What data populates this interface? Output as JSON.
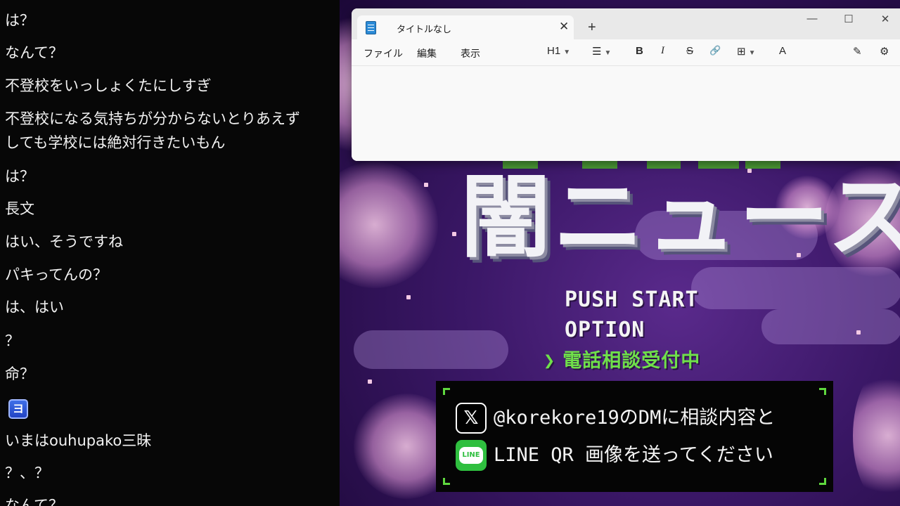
{
  "chat": {
    "messages": [
      "は？",
      "なんて？",
      "不登校をいっしょくたにしすぎ",
      "不登校になる気持ちが分からないとりあえず",
      "しても学校には絶対行きたいもん",
      "は？",
      "長文",
      "はい、そうですね",
      "パキってんの？",
      "は、はい",
      "？",
      "命？",
      "いまはouhupako三昧",
      "？、？",
      "なんて？"
    ],
    "badge": "ヨ"
  },
  "notepad": {
    "tab_title": "タイトルなし",
    "tab_close": "✕",
    "new_tab": "+",
    "window_controls": {
      "minimize": "—",
      "maximize": "☐",
      "close": "✕"
    },
    "menus": [
      "ファイル",
      "編集",
      "表示"
    ],
    "toolbar": {
      "heading": "H1",
      "list": "☰",
      "bold": "B",
      "italic": "I",
      "strike": "S",
      "link": "🔗",
      "table": "⊞",
      "spell": "A"
    },
    "settings": "⚙",
    "copilot": "✎"
  },
  "game": {
    "title": "闇ニュース",
    "menu": [
      "PUSH START",
      "OPTION"
    ],
    "phone_arrow": "❯",
    "phone_text": "電話相談受付中",
    "info": {
      "x_icon": "𝕏",
      "line1": "@korekore19のDMに相談内容と",
      "line_icon": "LINE",
      "line2": "LINE QR 画像を送ってください"
    }
  }
}
